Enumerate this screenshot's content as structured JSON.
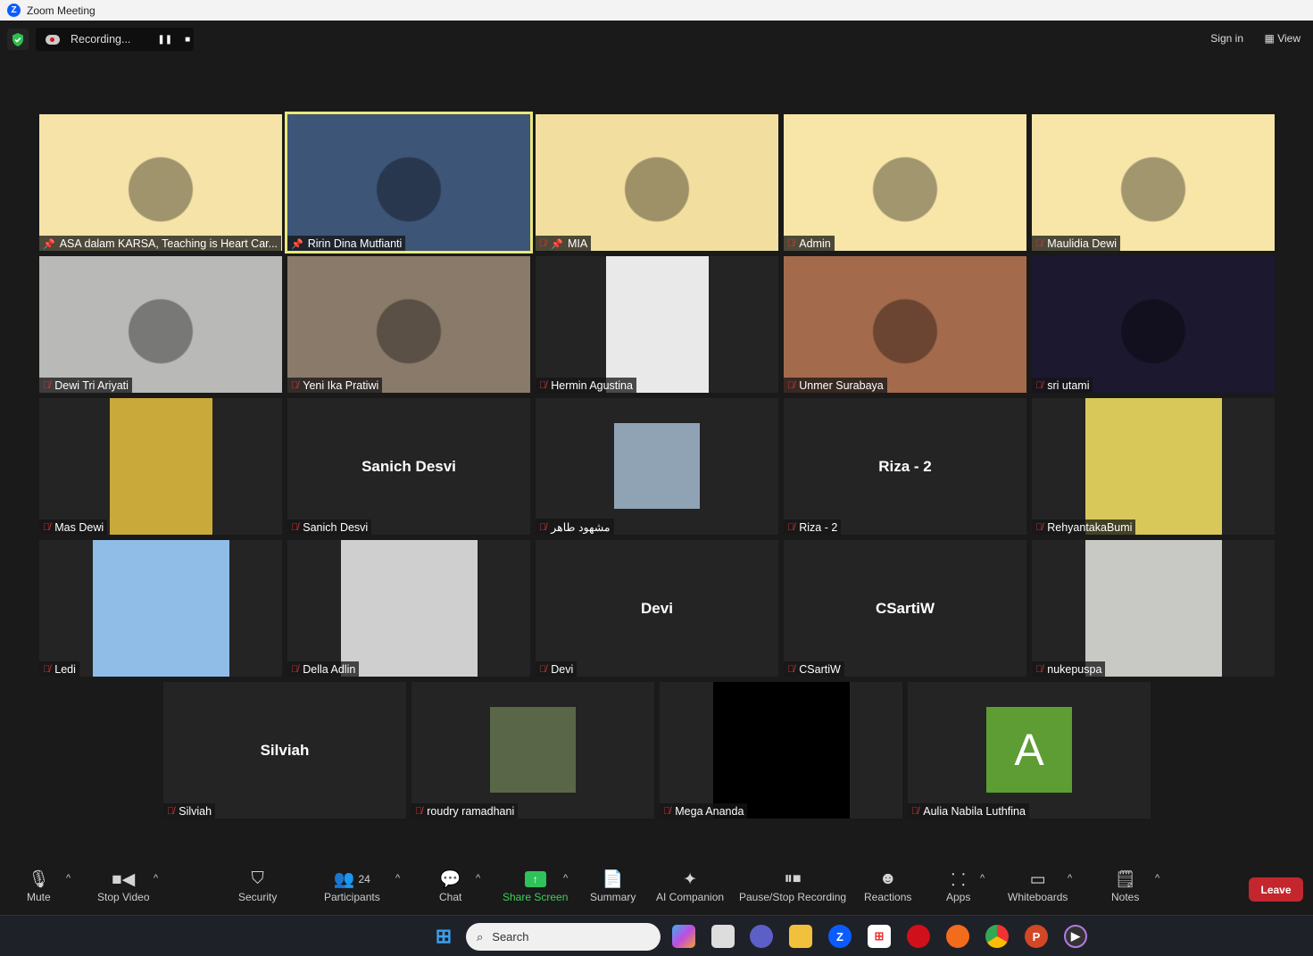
{
  "window": {
    "title": "Zoom Meeting"
  },
  "topbar": {
    "recording_label": "Recording...",
    "sign_in": "Sign in",
    "view": "View"
  },
  "tiles": [
    {
      "name": "ASA dalam KARSA, Teaching is Heart Car...",
      "pinned": true,
      "muted": false,
      "kind": "video",
      "color": "#f5e3a8"
    },
    {
      "name": "Ririn Dina Mutfianti",
      "pinned": true,
      "muted": false,
      "kind": "video",
      "color": "#3d5577",
      "active": true
    },
    {
      "name": "MIA",
      "pinned": true,
      "muted": true,
      "kind": "video",
      "color": "#f2df9f"
    },
    {
      "name": "Admin",
      "muted": true,
      "kind": "video",
      "color": "#f7e6a8"
    },
    {
      "name": "Maulidia Dewi",
      "muted": true,
      "kind": "video",
      "color": "#f7e6a8"
    },
    {
      "name": "Dewi Tri Ariyati",
      "muted": true,
      "kind": "video",
      "color": "#b9b9b7"
    },
    {
      "name": "Yeni Ika Pratiwi",
      "muted": true,
      "kind": "video",
      "color": "#8a7a6a"
    },
    {
      "name": "Hermin Agustina",
      "muted": true,
      "kind": "image",
      "color": "#e9e9e9",
      "w": 115
    },
    {
      "name": "Unmer Surabaya",
      "muted": true,
      "kind": "video",
      "color": "#a46a4c"
    },
    {
      "name": "sri utami",
      "muted": true,
      "kind": "video",
      "color": "#1c1830"
    },
    {
      "name": "Mas Dewi",
      "muted": true,
      "kind": "image",
      "color": "#c9a93a",
      "w": 115
    },
    {
      "name": "Sanich Desvi",
      "muted": true,
      "kind": "name",
      "display": "Sanich Desvi"
    },
    {
      "name": "مشهود طاهر",
      "muted": true,
      "kind": "thumb",
      "color": "#8fa3b5"
    },
    {
      "name": "Riza - 2",
      "muted": true,
      "kind": "name",
      "display": "Riza - 2"
    },
    {
      "name": "RehyantakaBumi",
      "muted": true,
      "kind": "image",
      "color": "#d8c85a",
      "w": 153
    },
    {
      "name": "Ledi",
      "muted": true,
      "kind": "image",
      "color": "#8fbde8",
      "w": 153
    },
    {
      "name": "Della Adlin",
      "muted": true,
      "kind": "image",
      "color": "#cfcfcf",
      "w": 153
    },
    {
      "name": "Devi",
      "muted": true,
      "kind": "name",
      "display": "Devi"
    },
    {
      "name": "CSartiW",
      "muted": true,
      "kind": "name",
      "display": "CSartiW"
    },
    {
      "name": "nukepuspa",
      "muted": true,
      "kind": "image",
      "color": "#c8c8c4",
      "w": 153
    },
    {
      "name": "Silviah",
      "muted": true,
      "kind": "name",
      "display": "Silviah"
    },
    {
      "name": "roudry ramadhani",
      "muted": true,
      "kind": "thumb",
      "color": "#5a6648"
    },
    {
      "name": "Mega Ananda",
      "muted": true,
      "kind": "image",
      "color": "#000000",
      "w": 153
    },
    {
      "name": "Aulia Nabila Luthfina",
      "muted": true,
      "kind": "avatar",
      "letter": "A"
    }
  ],
  "toolbar": {
    "mute": "Mute",
    "stop_video": "Stop Video",
    "security": "Security",
    "participants": "Participants",
    "participants_count": "24",
    "chat": "Chat",
    "share_screen": "Share Screen",
    "summary": "Summary",
    "ai_companion": "AI Companion",
    "pause_stop_recording": "Pause/Stop Recording",
    "reactions": "Reactions",
    "apps": "Apps",
    "whiteboards": "Whiteboards",
    "notes": "Notes",
    "leave": "Leave"
  },
  "taskbar": {
    "search_placeholder": "Search"
  },
  "colors": {
    "leave": "#c4262e",
    "share": "#3ecf5d",
    "active_speaker": "#e8e87a",
    "muted": "#e03434"
  }
}
